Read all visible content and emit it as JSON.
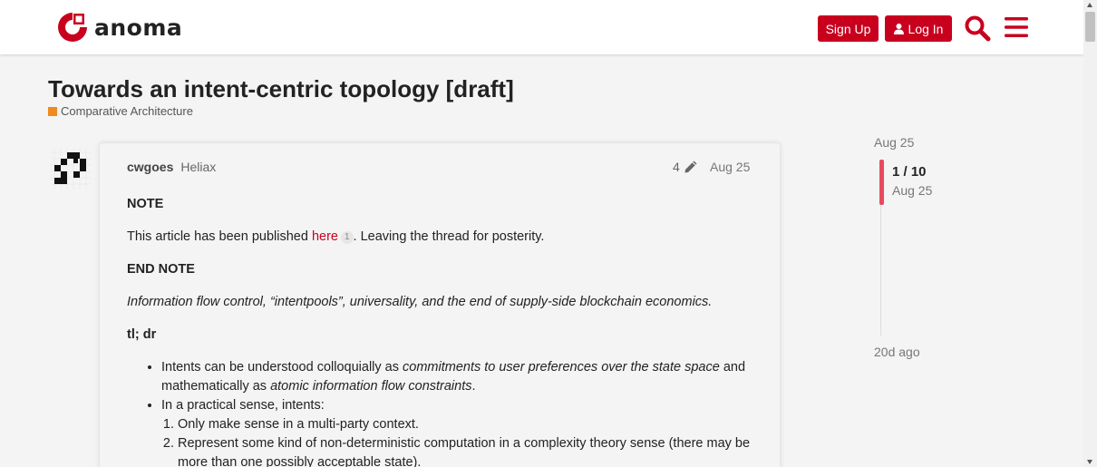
{
  "brand": {
    "name": "anoma",
    "accent": "#c8001e"
  },
  "header": {
    "signup_label": "Sign Up",
    "login_label": "Log In",
    "icons": [
      "search-icon",
      "hamburger-menu-icon",
      "user-icon"
    ]
  },
  "topic": {
    "title": "Towards an intent-centric topology [draft]",
    "category": "Comparative Architecture",
    "category_color": "#ee8a1e"
  },
  "post": {
    "username": "cwgoes",
    "user_title": "Heliax",
    "edit_count": "4",
    "date": "Aug 25",
    "note_heading": "NOTE",
    "published_pre": "This article has been published ",
    "published_link": "here",
    "published_link_clicks": "1",
    "published_post": ". Leaving the thread for posterity.",
    "end_note": "END NOTE",
    "subtitle": "Information flow control, “intentpools”, universality, and the end of supply-side blockchain economics.",
    "tldr": "tl; dr",
    "bullet1_a": "Intents can be understood colloquially as ",
    "bullet1_b": "commitments to user preferences over the state space",
    "bullet1_c": " and mathematically as ",
    "bullet1_d": "atomic information flow constraints",
    "bullet1_e": ".",
    "bullet2": "In a practical sense, intents:",
    "sub1": "Only make sense in a multi-party context.",
    "sub2": "Represent some kind of non-deterministic computation in a complexity theory sense (there may be more than one possibly acceptable state)."
  },
  "timeline": {
    "start_date": "Aug 25",
    "position": "1 / 10",
    "position_date": "Aug 25",
    "end_label": "20d ago"
  }
}
